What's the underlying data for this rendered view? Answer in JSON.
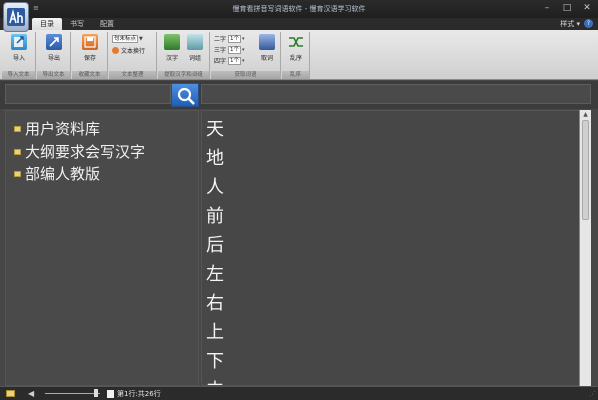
{
  "window": {
    "title": "慢育看拼音写词语软件 - 慢育汉语学习软件",
    "qat": "≡",
    "minimize": "–",
    "maximize": "□",
    "close": "✕"
  },
  "tabs": [
    {
      "label": "目录",
      "active": true
    },
    {
      "label": "书写",
      "active": false
    },
    {
      "label": "配置",
      "active": false
    }
  ],
  "style_menu": "样式 ▾",
  "help": "?",
  "ribbon": {
    "import": {
      "label": "导入",
      "group": "导入文本"
    },
    "export": {
      "label": "导出",
      "group": "导出文本"
    },
    "save": {
      "label": "保存",
      "group": "收藏文本"
    },
    "text_options": {
      "select": "句末标点",
      "wrap": "文本换行",
      "group": "文本整理"
    },
    "hanzi_btn": {
      "label": "汉字"
    },
    "ciyu_btn": {
      "label": "词组"
    },
    "extract_group": "提取汉字和词组",
    "pick": {
      "rows": [
        {
          "label": "二字",
          "value": "1个"
        },
        {
          "label": "三字",
          "value": "1个"
        },
        {
          "label": "四字",
          "value": "1个"
        }
      ],
      "button": "取词",
      "group": "获取词语"
    },
    "shuffle": {
      "label": "乱序",
      "group": "乱序"
    }
  },
  "tree": {
    "items": [
      {
        "label": "用户资料库"
      },
      {
        "label": "大纲要求会写汉字"
      },
      {
        "label": "部编人教版"
      }
    ]
  },
  "characters": [
    "天",
    "地",
    "人",
    "前",
    "后",
    "左",
    "右",
    "上",
    "下",
    "中"
  ],
  "status": {
    "text": "第1行:共26行"
  },
  "colors": {
    "background": "#474747",
    "ribbon": "#dcdcdc",
    "search_button": "#2f73cf",
    "folder": "#e8d27a"
  },
  "icons": [
    "app-logo-icon",
    "search-icon",
    "folder-icon",
    "speaker-icon",
    "import-icon",
    "export-icon",
    "save-icon",
    "hanzi-icon",
    "ciyu-icon",
    "pick-words-icon",
    "shuffle-icon"
  ]
}
